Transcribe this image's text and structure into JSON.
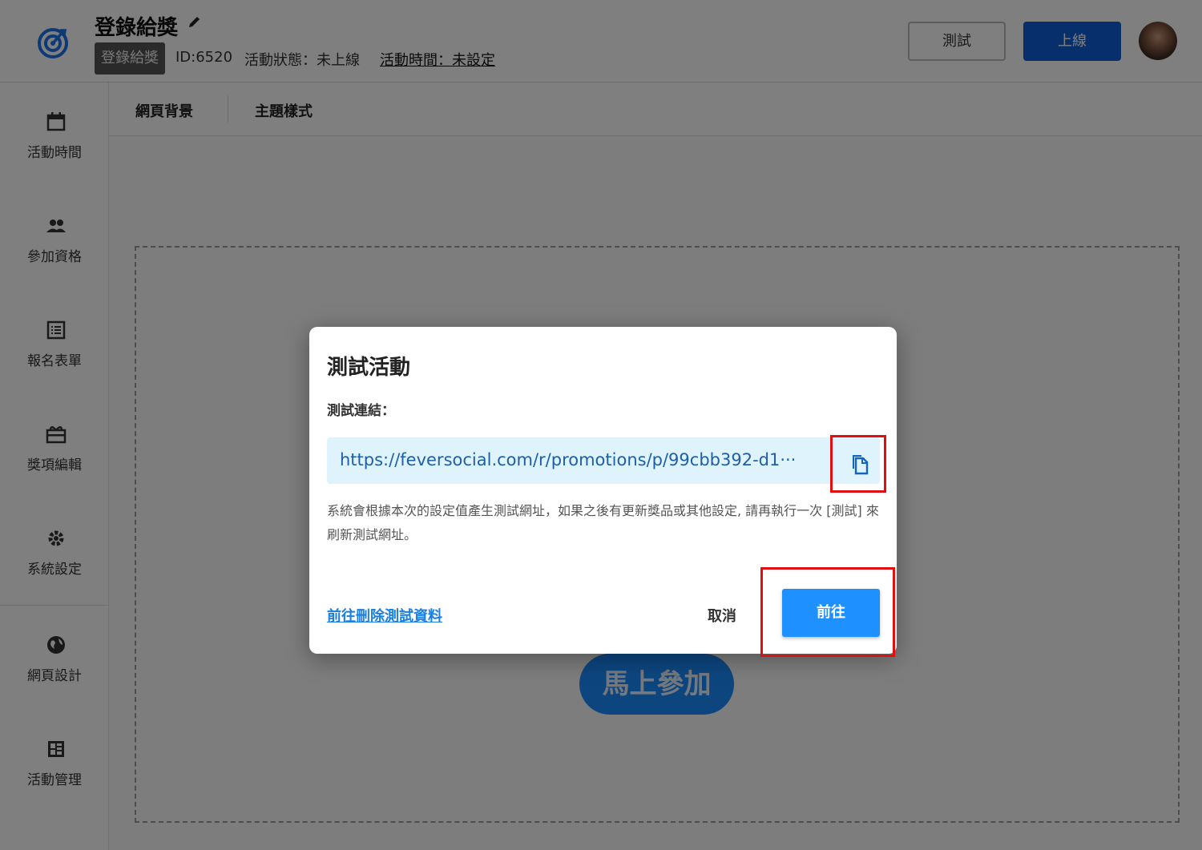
{
  "header": {
    "title": "登錄給獎",
    "tag": "登錄給獎",
    "id_text": "ID:6520",
    "status_text": "活動狀態：未上線",
    "time_link": "活動時間：未設定",
    "test_button": "測試",
    "publish_button": "上線",
    "icons": {
      "logo": "target-logo-icon",
      "edit": "pencil-icon"
    }
  },
  "sidebar": {
    "items": [
      {
        "label": "活動時間",
        "icon": "calendar-icon"
      },
      {
        "label": "參加資格",
        "icon": "people-icon"
      },
      {
        "label": "報名表單",
        "icon": "list-form-icon"
      },
      {
        "label": "獎項編輯",
        "icon": "gift-icon"
      },
      {
        "label": "系統設定",
        "icon": "gear-icon"
      },
      {
        "label": "網頁設計",
        "icon": "globe-icon"
      },
      {
        "label": "活動管理",
        "icon": "dashboard-icon"
      }
    ]
  },
  "tabs": [
    "網頁背景",
    "主題樣式"
  ],
  "canvas": {
    "join_button": "馬上參加"
  },
  "dialog": {
    "title": "測試活動",
    "link_label": "測試連結：",
    "url": "https://feversocial.com/r/promotions/p/99cbb392-d1···",
    "copy_icon": "copy-icon",
    "note": "系統會根據本次的設定值產生測試網址，如果之後有更新獎品或其他設定, 請再執行一次 [測試] 來刷新測試網址。",
    "delete_link": "前往刪除測試資料",
    "cancel_button": "取消",
    "go_button": "前往"
  },
  "colors": {
    "primary": "#0d5fd6",
    "go_button": "#1e90ff",
    "highlight": "#e01010",
    "url_bg": "#def3fb"
  }
}
